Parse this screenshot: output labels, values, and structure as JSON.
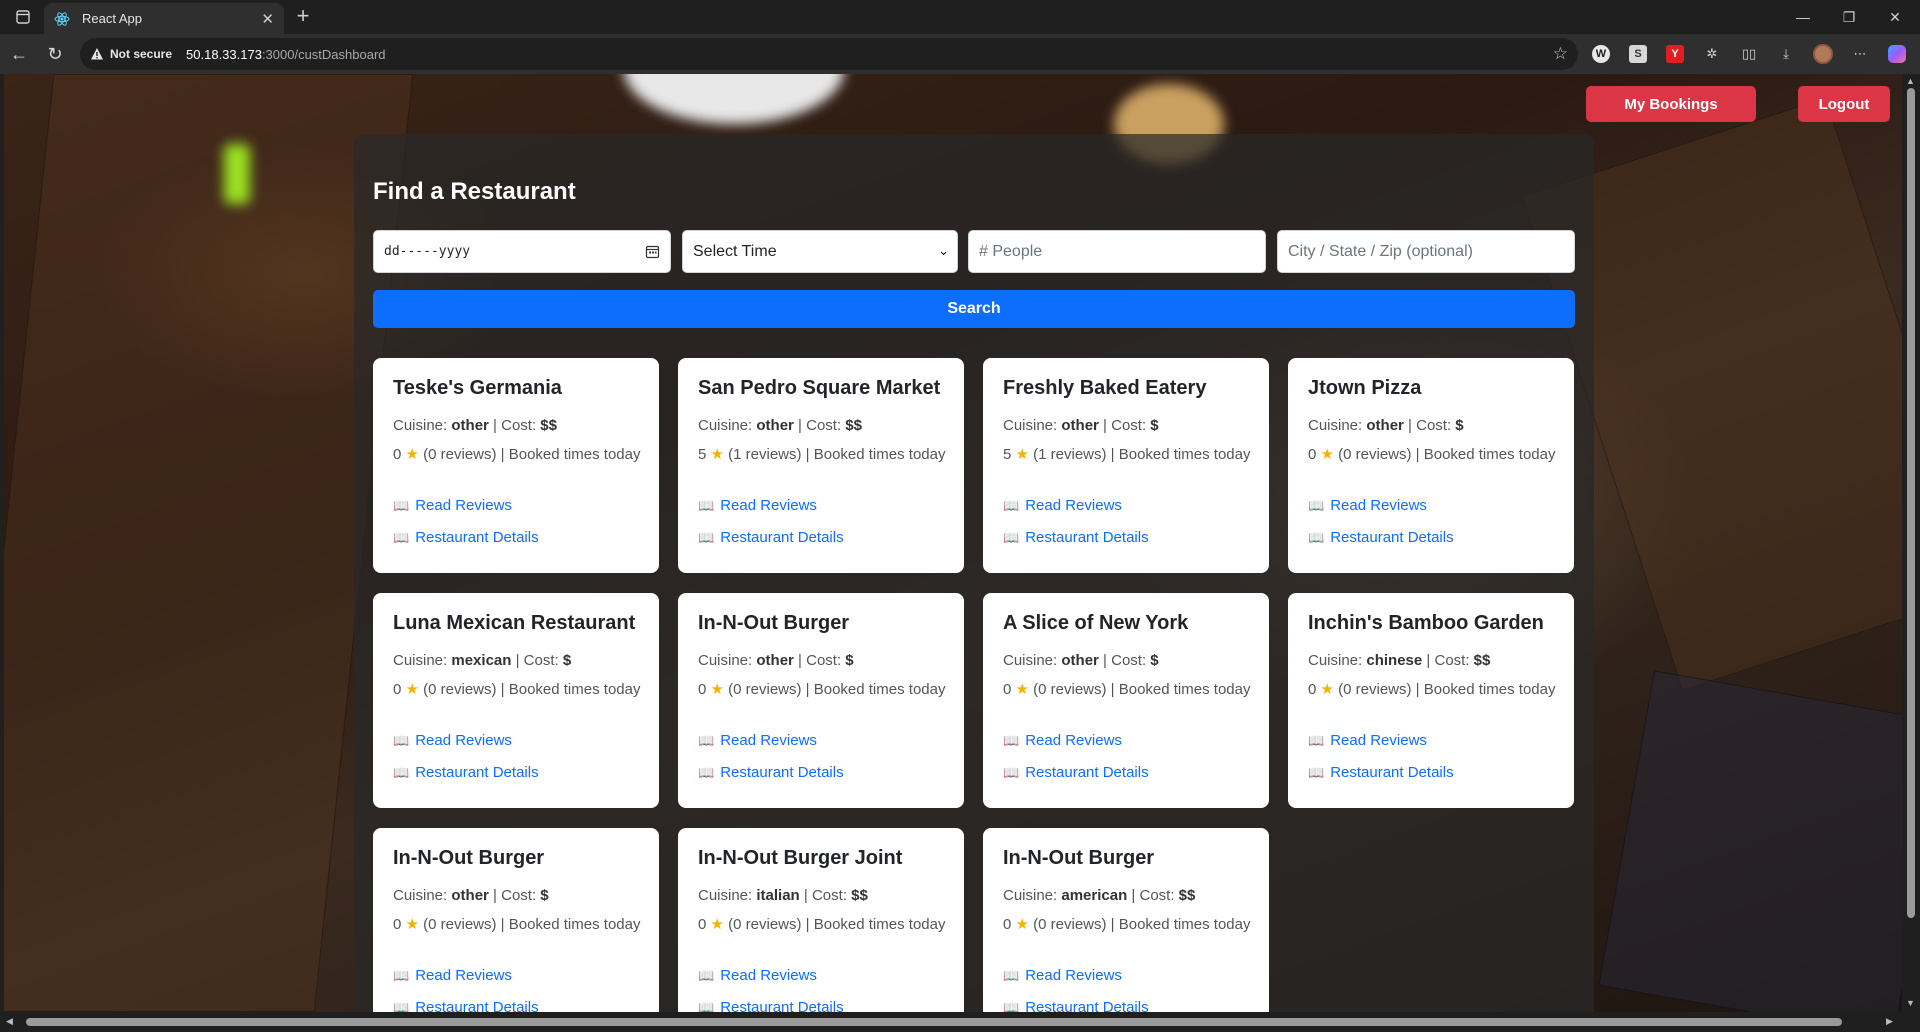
{
  "browser": {
    "tab_title": "React App",
    "security_label": "Not secure",
    "url_host": "50.18.33.173",
    "url_path": ":3000/custDashboard"
  },
  "header": {
    "my_bookings": "My Bookings",
    "logout": "Logout"
  },
  "search": {
    "title": "Find a Restaurant",
    "date_value": "dd-----yyyy",
    "time_value": "Select Time",
    "people_placeholder": "# People",
    "location_placeholder": "City / State / Zip (optional)",
    "button": "Search"
  },
  "labels": {
    "cuisine": "Cuisine:",
    "cost": "| Cost:",
    "reviews_suffix": "reviews) | Booked times today",
    "read_reviews": "Read Reviews",
    "restaurant_details": "Restaurant Details"
  },
  "restaurants": [
    {
      "name": "Teske's Germania",
      "cuisine": "other",
      "cost": "$$",
      "rating": "0",
      "reviews": "(0"
    },
    {
      "name": "San Pedro Square Market",
      "cuisine": "other",
      "cost": "$$",
      "rating": "5",
      "reviews": "(1"
    },
    {
      "name": "Freshly Baked Eatery",
      "cuisine": "other",
      "cost": "$",
      "rating": "5",
      "reviews": "(1"
    },
    {
      "name": "Jtown Pizza",
      "cuisine": "other",
      "cost": "$",
      "rating": "0",
      "reviews": "(0"
    },
    {
      "name": "Luna Mexican Restaurant",
      "cuisine": "mexican",
      "cost": "$",
      "rating": "0",
      "reviews": "(0"
    },
    {
      "name": "In-N-Out Burger",
      "cuisine": "other",
      "cost": "$",
      "rating": "0",
      "reviews": "(0"
    },
    {
      "name": "A Slice of New York",
      "cuisine": "other",
      "cost": "$",
      "rating": "0",
      "reviews": "(0"
    },
    {
      "name": "Inchin's Bamboo Garden",
      "cuisine": "chinese",
      "cost": "$$",
      "rating": "0",
      "reviews": "(0"
    },
    {
      "name": "In-N-Out Burger",
      "cuisine": "other",
      "cost": "$",
      "rating": "0",
      "reviews": "(0"
    },
    {
      "name": "In-N-Out Burger Joint",
      "cuisine": "italian",
      "cost": "$$",
      "rating": "0",
      "reviews": "(0"
    },
    {
      "name": "In-N-Out Burger",
      "cuisine": "american",
      "cost": "$$",
      "rating": "0",
      "reviews": "(0"
    }
  ],
  "colors": {
    "danger": "#dc3545",
    "primary": "#0d6efd",
    "star": "#f5b301"
  }
}
